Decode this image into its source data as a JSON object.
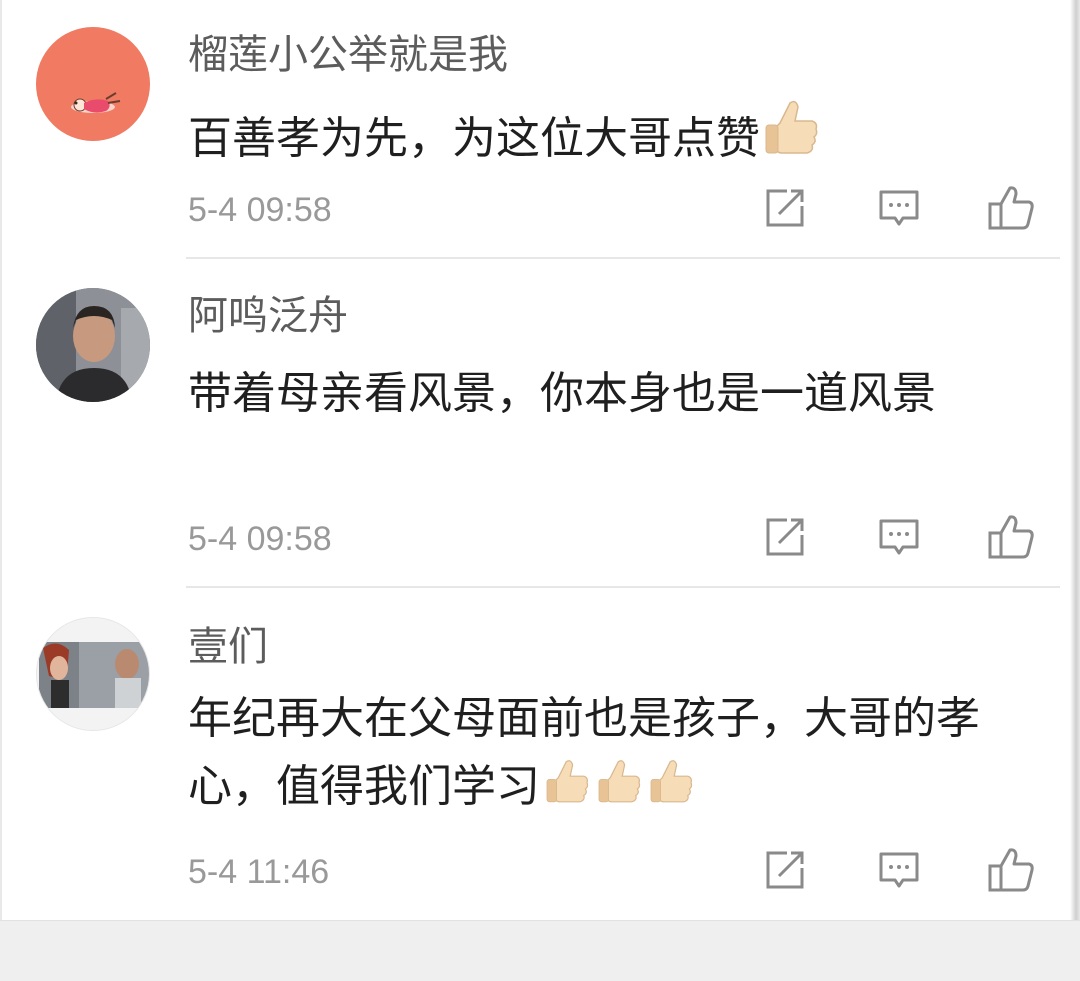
{
  "comments": [
    {
      "username": "榴莲小公举就是我",
      "text": "百善孝为先，为这位大哥点赞",
      "emoji_count": 1,
      "time": "5-4 09:58"
    },
    {
      "username": "阿鸣泛舟",
      "text": "带着母亲看风景，你本身也是一道风景",
      "emoji_count": 0,
      "time": "5-4 09:58"
    },
    {
      "username": "壹们",
      "text": "年纪再大在父母面前也是孩子，大哥的孝心，值得我们学习",
      "emoji_count": 3,
      "time": "5-4 11:46"
    }
  ],
  "icons": {
    "forward": "share-edit-icon",
    "reply": "comment-icon",
    "like": "thumbs-up-icon",
    "emoji": "thumbs-up-emoji"
  },
  "colors": {
    "username": "#5c5c5c",
    "text": "#1f1f1f",
    "time": "#999999",
    "icon": "#8a8a8a",
    "avatar1_bg": "#f07a62"
  }
}
